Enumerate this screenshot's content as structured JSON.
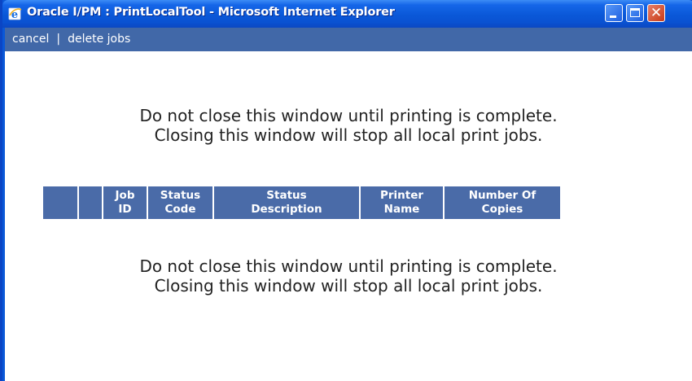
{
  "window": {
    "title": "Oracle I/PM : PrintLocalTool - Microsoft Internet Explorer",
    "title_icon": "internet-explorer-icon",
    "controls": {
      "minimize": "minimize-icon",
      "maximize": "maximize-icon",
      "close_glyph": "✕"
    }
  },
  "nav": {
    "cancel_label": "cancel",
    "separator": "|",
    "delete_jobs_label": "delete jobs"
  },
  "messages": {
    "top_line1": "Do not close this window until printing is complete.",
    "top_line2": "Closing this window will stop all local print jobs.",
    "bottom_line1": "Do not close this window until printing is complete.",
    "bottom_line2": "Closing this window will stop all local print jobs."
  },
  "table": {
    "columns": [
      {
        "line1": "",
        "line2": ""
      },
      {
        "line1": "",
        "line2": ""
      },
      {
        "line1": "Job",
        "line2": "ID"
      },
      {
        "line1": "Status",
        "line2": "Code"
      },
      {
        "line1": "Status",
        "line2": "Description"
      },
      {
        "line1": "Printer",
        "line2": "Name"
      },
      {
        "line1": "Number Of",
        "line2": "Copies"
      }
    ],
    "rows": []
  },
  "colors": {
    "titlebar": "#0a58d8",
    "navbar": "#4168a8",
    "table_header": "#4a6ba8",
    "close_button": "#c73a17"
  }
}
